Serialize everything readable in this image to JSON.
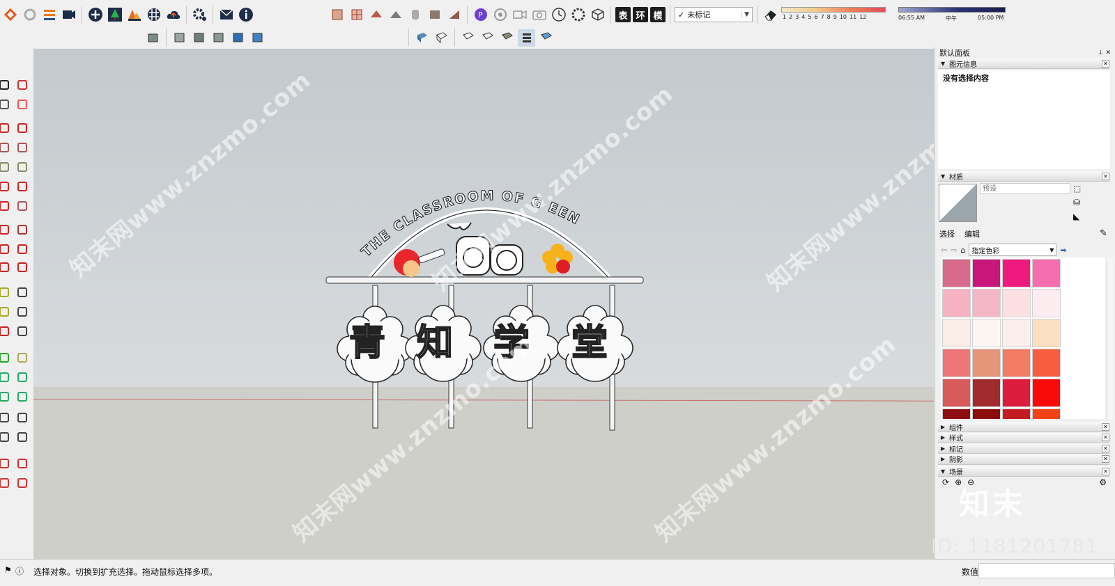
{
  "toolbar": {
    "tag_select_value": "未标记",
    "tag_check": "✓",
    "shadow_months": [
      "1",
      "2",
      "3",
      "4",
      "5",
      "6",
      "7",
      "8",
      "9",
      "10",
      "11",
      "12"
    ],
    "time_start": "06:55 AM",
    "time_mid": "中午",
    "time_end": "05:00 PM",
    "text_btns": [
      "表",
      "环",
      "模"
    ]
  },
  "tray": {
    "title": "默认面板",
    "entity_info_label": "图元信息",
    "entity_empty": "没有选择内容",
    "materials_label": "材质",
    "material_name_placeholder": "预设",
    "tab_select": "选择",
    "tab_edit": "编辑",
    "collection": "指定色彩",
    "swatches": [
      "#d86b8b",
      "#c8167a",
      "#f01a7f",
      "#f46eb0",
      "#f7b2c2",
      "#f4b7c6",
      "#fce0e1",
      "#fcecf0",
      "#faece6",
      "#fcf6f2",
      "#fbefec",
      "#fbdfc0",
      "#ee7676",
      "#e4957a",
      "#f27b63",
      "#f65d3e",
      "#d95a5a",
      "#a12a2e",
      "#dc1c3c",
      "#f80a0a",
      "#8f0c12",
      "#8c0b0b",
      "#c21c22",
      "#f34316"
    ],
    "collapsed_sections": [
      "组件",
      "样式",
      "标记",
      "阴影"
    ],
    "scenes_label": "场景",
    "logo": "知末",
    "id_text": "ID: 1181201781"
  },
  "viewport": {
    "sign_arc_text": "THE CLASSROOM OF G EEN",
    "sign_chars": [
      "青",
      "知",
      "学",
      "堂"
    ],
    "watermark": "知末网www.znzmo.com"
  },
  "status": {
    "text": "选择对象。切换到扩充选择。拖动鼠标选择多项。",
    "measure_label": "数值"
  }
}
